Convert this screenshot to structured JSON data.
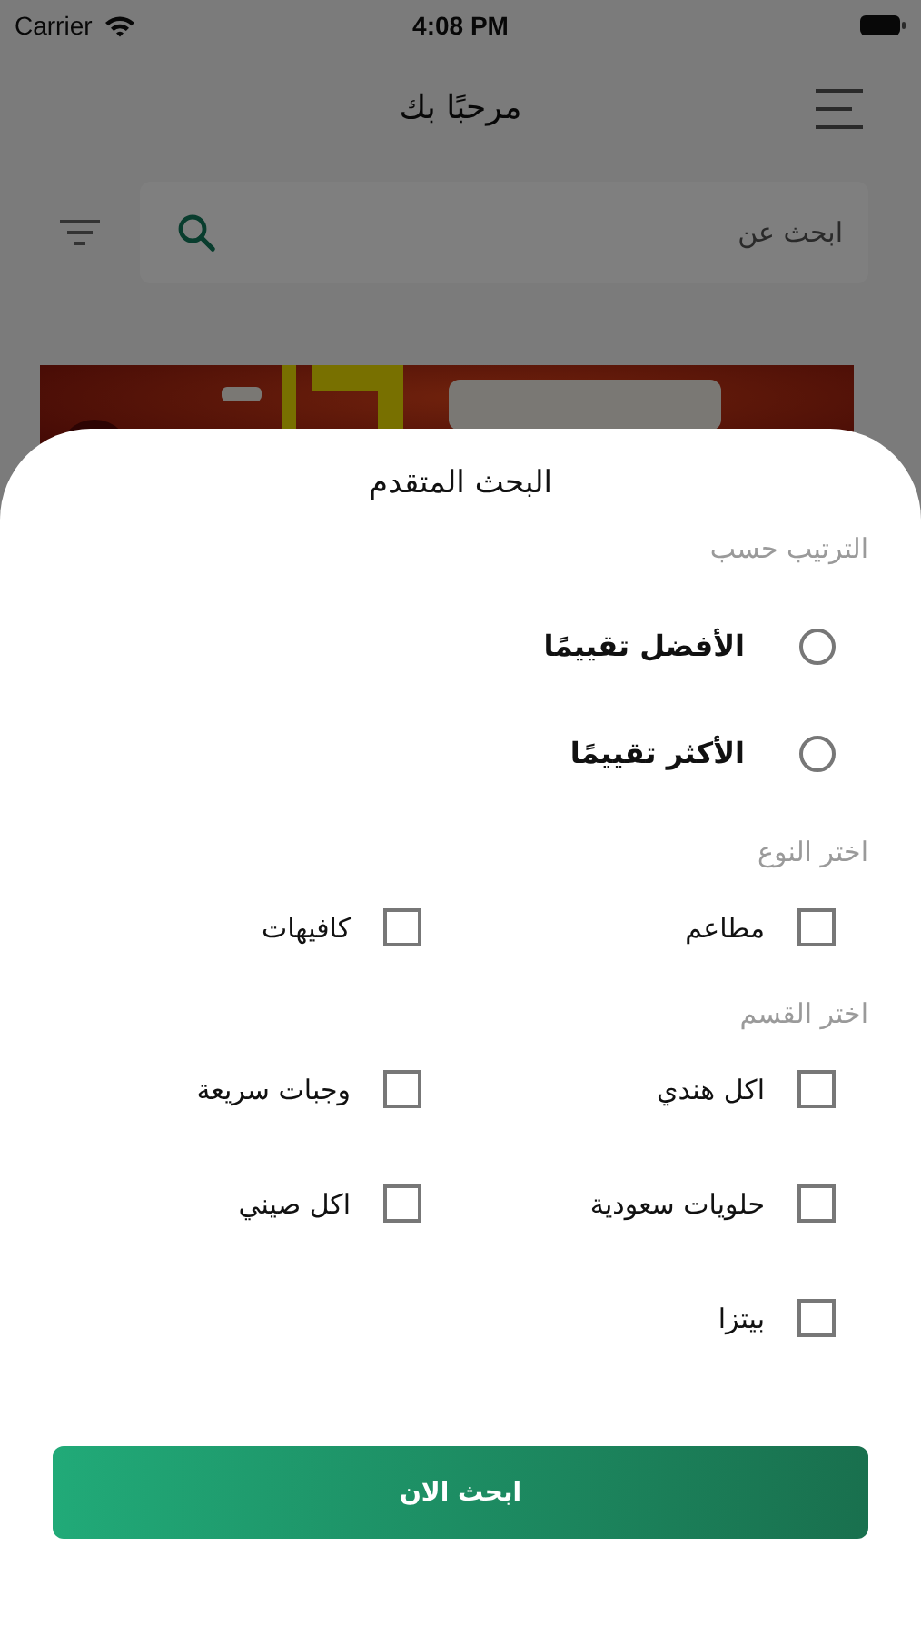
{
  "status_bar": {
    "carrier": "Carrier",
    "time": "4:08 PM"
  },
  "header": {
    "title": "مرحبًا بك"
  },
  "search": {
    "placeholder": "ابحث عن"
  },
  "sheet": {
    "title": "البحث المتقدم",
    "sections": [
      {
        "label": "الترتيب حسب",
        "kind": "radio",
        "options": [
          {
            "label": "الأفضل تقييمًا",
            "selected": false
          },
          {
            "label": "الأكثر تقييمًا",
            "selected": false
          }
        ]
      },
      {
        "label": "اختر النوع",
        "kind": "checkbox",
        "options": [
          {
            "label": "مطاعم",
            "checked": false
          },
          {
            "label": "كافيهات",
            "checked": false
          }
        ]
      },
      {
        "label": "اختر القسم",
        "kind": "checkbox",
        "options": [
          {
            "label": "اكل هندي",
            "checked": false
          },
          {
            "label": "وجبات سريعة",
            "checked": false
          },
          {
            "label": "حلويات سعودية",
            "checked": false
          },
          {
            "label": "اكل صيني",
            "checked": false
          },
          {
            "label": "بيتزا",
            "checked": false
          }
        ]
      }
    ],
    "button": "ابحث الان"
  }
}
